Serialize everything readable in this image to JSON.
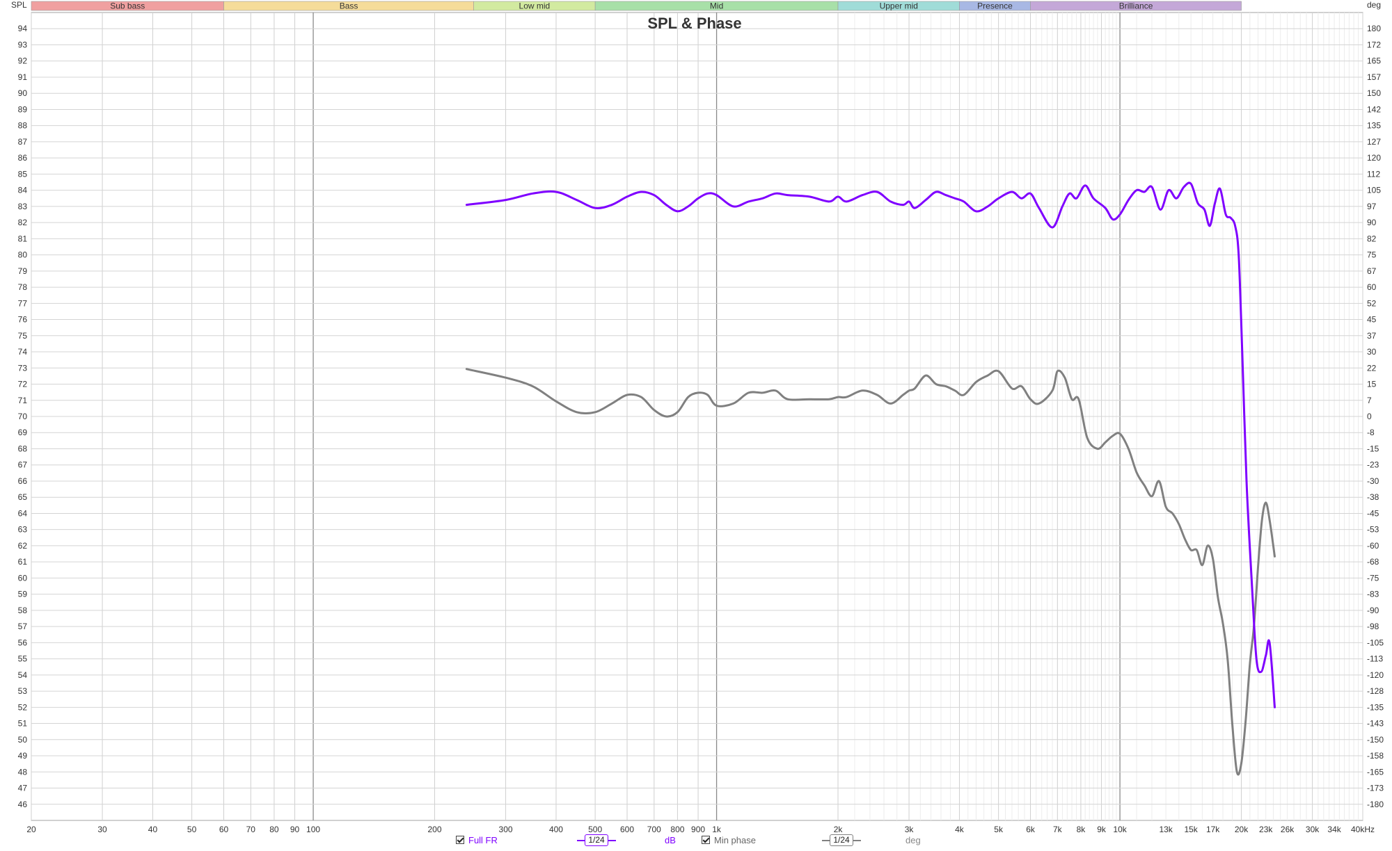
{
  "chart_data": {
    "type": "line",
    "title": "SPL & Phase",
    "left_axis_label": "SPL",
    "right_axis_label": "deg",
    "x_scale": "log",
    "xlim": [
      20,
      40000
    ],
    "ylim_left": [
      45,
      95
    ],
    "ylim_right": [
      -187.5,
      187.5
    ],
    "grid": true,
    "x_tick_labels": [
      {
        "f": 20,
        "label": "20"
      },
      {
        "f": 30,
        "label": "30"
      },
      {
        "f": 40,
        "label": "40"
      },
      {
        "f": 50,
        "label": "50"
      },
      {
        "f": 60,
        "label": "60"
      },
      {
        "f": 70,
        "label": "70"
      },
      {
        "f": 80,
        "label": "80"
      },
      {
        "f": 90,
        "label": "90"
      },
      {
        "f": 100,
        "label": "100"
      },
      {
        "f": 200,
        "label": "200"
      },
      {
        "f": 300,
        "label": "300"
      },
      {
        "f": 400,
        "label": "400"
      },
      {
        "f": 500,
        "label": "500"
      },
      {
        "f": 600,
        "label": "600"
      },
      {
        "f": 700,
        "label": "700"
      },
      {
        "f": 800,
        "label": "800"
      },
      {
        "f": 900,
        "label": "900"
      },
      {
        "f": 1000,
        "label": "1k"
      },
      {
        "f": 2000,
        "label": "2k"
      },
      {
        "f": 3000,
        "label": "3k"
      },
      {
        "f": 4000,
        "label": "4k"
      },
      {
        "f": 5000,
        "label": "5k"
      },
      {
        "f": 6000,
        "label": "6k"
      },
      {
        "f": 7000,
        "label": "7k"
      },
      {
        "f": 8000,
        "label": "8k"
      },
      {
        "f": 9000,
        "label": "9k"
      },
      {
        "f": 10000,
        "label": "10k"
      },
      {
        "f": 13000,
        "label": "13k"
      },
      {
        "f": 15000,
        "label": "15k"
      },
      {
        "f": 17000,
        "label": "17k"
      },
      {
        "f": 20000,
        "label": "20k"
      },
      {
        "f": 23000,
        "label": "23k"
      },
      {
        "f": 26000,
        "label": "26k"
      },
      {
        "f": 30000,
        "label": "30k"
      },
      {
        "f": 34000,
        "label": "34k"
      },
      {
        "f": 40000,
        "label": "40kHz"
      }
    ],
    "y_left_ticks": [
      "94",
      "93",
      "92",
      "91",
      "90",
      "89",
      "88",
      "87",
      "86",
      "85",
      "84",
      "83",
      "82",
      "81",
      "80",
      "79",
      "78",
      "77",
      "76",
      "75",
      "74",
      "73",
      "72",
      "71",
      "70",
      "69",
      "68",
      "67",
      "66",
      "65",
      "64",
      "63",
      "62",
      "61",
      "60",
      "59",
      "58",
      "57",
      "56",
      "55",
      "54",
      "53",
      "52",
      "51",
      "50",
      "49",
      "48",
      "47",
      "46"
    ],
    "y_right_ticks": [
      "180",
      "172",
      "165",
      "157",
      "150",
      "142",
      "135",
      "127",
      "120",
      "112",
      "105",
      "97",
      "90",
      "82",
      "75",
      "67",
      "60",
      "52",
      "45",
      "37",
      "30",
      "22",
      "15",
      "7",
      "0",
      "-8",
      "-15",
      "-23",
      "-30",
      "-38",
      "-45",
      "-53",
      "-60",
      "-68",
      "-75",
      "-83",
      "-90",
      "-98",
      "-105",
      "-113",
      "-120",
      "-128",
      "-135",
      "-143",
      "-150",
      "-158",
      "-165",
      "-173",
      "-180"
    ],
    "bands": [
      {
        "name": "Sub bass",
        "from": 20,
        "to": 60,
        "color": "#f0a0a0"
      },
      {
        "name": "Bass",
        "from": 60,
        "to": 250,
        "color": "#f5dc9a"
      },
      {
        "name": "Low mid",
        "from": 250,
        "to": 500,
        "color": "#d2eaa0"
      },
      {
        "name": "Mid",
        "from": 500,
        "to": 2000,
        "color": "#a8e0a8"
      },
      {
        "name": "Upper mid",
        "from": 2000,
        "to": 4000,
        "color": "#a0dcd8"
      },
      {
        "name": "Presence",
        "from": 4000,
        "to": 6000,
        "color": "#a8b8e4"
      },
      {
        "name": "Brilliance",
        "from": 6000,
        "to": 20000,
        "color": "#c4a8d8"
      }
    ],
    "series": [
      {
        "name": "Full FR",
        "axis": "left",
        "unit": "dB",
        "color": "#7f00ff",
        "points": [
          [
            240,
            83.1
          ],
          [
            300,
            83.4
          ],
          [
            350,
            83.8
          ],
          [
            400,
            83.9
          ],
          [
            450,
            83.4
          ],
          [
            500,
            82.9
          ],
          [
            550,
            83.1
          ],
          [
            600,
            83.6
          ],
          [
            650,
            83.9
          ],
          [
            700,
            83.7
          ],
          [
            750,
            83.1
          ],
          [
            800,
            82.7
          ],
          [
            850,
            83.0
          ],
          [
            900,
            83.5
          ],
          [
            950,
            83.8
          ],
          [
            1000,
            83.7
          ],
          [
            1100,
            83.0
          ],
          [
            1200,
            83.3
          ],
          [
            1300,
            83.5
          ],
          [
            1400,
            83.8
          ],
          [
            1500,
            83.7
          ],
          [
            1700,
            83.6
          ],
          [
            1900,
            83.3
          ],
          [
            2000,
            83.6
          ],
          [
            2100,
            83.3
          ],
          [
            2300,
            83.7
          ],
          [
            2500,
            83.9
          ],
          [
            2700,
            83.3
          ],
          [
            2900,
            83.1
          ],
          [
            3000,
            83.3
          ],
          [
            3100,
            82.9
          ],
          [
            3300,
            83.4
          ],
          [
            3500,
            83.9
          ],
          [
            3700,
            83.7
          ],
          [
            3900,
            83.5
          ],
          [
            4100,
            83.3
          ],
          [
            4400,
            82.7
          ],
          [
            4700,
            83.0
          ],
          [
            5000,
            83.5
          ],
          [
            5400,
            83.9
          ],
          [
            5700,
            83.5
          ],
          [
            6000,
            83.8
          ],
          [
            6300,
            82.9
          ],
          [
            6800,
            81.7
          ],
          [
            7200,
            83.0
          ],
          [
            7500,
            83.8
          ],
          [
            7800,
            83.5
          ],
          [
            8200,
            84.3
          ],
          [
            8600,
            83.5
          ],
          [
            9200,
            82.9
          ],
          [
            9600,
            82.2
          ],
          [
            10000,
            82.5
          ],
          [
            10500,
            83.4
          ],
          [
            11000,
            84.0
          ],
          [
            11500,
            83.9
          ],
          [
            12000,
            84.2
          ],
          [
            12600,
            82.8
          ],
          [
            13200,
            84.0
          ],
          [
            13800,
            83.5
          ],
          [
            14400,
            84.2
          ],
          [
            15000,
            84.4
          ],
          [
            15600,
            83.2
          ],
          [
            16200,
            82.8
          ],
          [
            16700,
            81.8
          ],
          [
            17200,
            83.2
          ],
          [
            17700,
            84.1
          ],
          [
            18300,
            82.5
          ],
          [
            18800,
            82.3
          ],
          [
            19300,
            81.8
          ],
          [
            19700,
            80.0
          ],
          [
            20100,
            74.0
          ],
          [
            20600,
            66.0
          ],
          [
            21200,
            60.0
          ],
          [
            21800,
            55.0
          ],
          [
            22400,
            54.2
          ],
          [
            23000,
            55.2
          ],
          [
            23500,
            56.0
          ],
          [
            24200,
            52.0
          ]
        ]
      },
      {
        "name": "Min phase",
        "axis": "right",
        "unit": "deg",
        "color": "#808080",
        "points": [
          [
            240,
            22
          ],
          [
            300,
            18
          ],
          [
            350,
            14
          ],
          [
            400,
            7
          ],
          [
            450,
            2
          ],
          [
            500,
            2
          ],
          [
            550,
            6
          ],
          [
            600,
            10
          ],
          [
            650,
            9
          ],
          [
            700,
            3
          ],
          [
            750,
            0
          ],
          [
            800,
            2
          ],
          [
            850,
            9
          ],
          [
            900,
            11
          ],
          [
            950,
            10
          ],
          [
            1000,
            5
          ],
          [
            1100,
            6
          ],
          [
            1200,
            11
          ],
          [
            1300,
            11
          ],
          [
            1400,
            12
          ],
          [
            1500,
            8
          ],
          [
            1700,
            8
          ],
          [
            1900,
            8
          ],
          [
            2000,
            9
          ],
          [
            2100,
            9
          ],
          [
            2300,
            12
          ],
          [
            2500,
            10
          ],
          [
            2700,
            6
          ],
          [
            2900,
            10
          ],
          [
            3000,
            12
          ],
          [
            3100,
            13
          ],
          [
            3300,
            19
          ],
          [
            3500,
            15
          ],
          [
            3700,
            14
          ],
          [
            3900,
            12
          ],
          [
            4100,
            10
          ],
          [
            4400,
            16
          ],
          [
            4700,
            19
          ],
          [
            5000,
            21
          ],
          [
            5400,
            13
          ],
          [
            5700,
            14
          ],
          [
            6000,
            8
          ],
          [
            6300,
            6
          ],
          [
            6800,
            12
          ],
          [
            7000,
            21
          ],
          [
            7300,
            18
          ],
          [
            7600,
            8
          ],
          [
            7900,
            8
          ],
          [
            8300,
            -10
          ],
          [
            8800,
            -15
          ],
          [
            9200,
            -12
          ],
          [
            9600,
            -9
          ],
          [
            10000,
            -8
          ],
          [
            10500,
            -15
          ],
          [
            11000,
            -26
          ],
          [
            11500,
            -32
          ],
          [
            12000,
            -37
          ],
          [
            12500,
            -30
          ],
          [
            13000,
            -42
          ],
          [
            13500,
            -45
          ],
          [
            14000,
            -50
          ],
          [
            14500,
            -57
          ],
          [
            15000,
            -62
          ],
          [
            15500,
            -62
          ],
          [
            16000,
            -69
          ],
          [
            16500,
            -60
          ],
          [
            17000,
            -66
          ],
          [
            17500,
            -84
          ],
          [
            18000,
            -96
          ],
          [
            18500,
            -113
          ],
          [
            19000,
            -143
          ],
          [
            19500,
            -165
          ],
          [
            20000,
            -161
          ],
          [
            20500,
            -141
          ],
          [
            21000,
            -115
          ],
          [
            21500,
            -97
          ],
          [
            22000,
            -70
          ],
          [
            22500,
            -48
          ],
          [
            23000,
            -40
          ],
          [
            23500,
            -48
          ],
          [
            24200,
            -65
          ]
        ]
      }
    ]
  },
  "legend": {
    "full_fr": {
      "label": "Full FR",
      "smoothing": "1/24",
      "unit": "dB",
      "checked": true
    },
    "min_phase": {
      "label": "Min phase",
      "smoothing": "1/24",
      "unit": "deg",
      "checked": true
    }
  }
}
